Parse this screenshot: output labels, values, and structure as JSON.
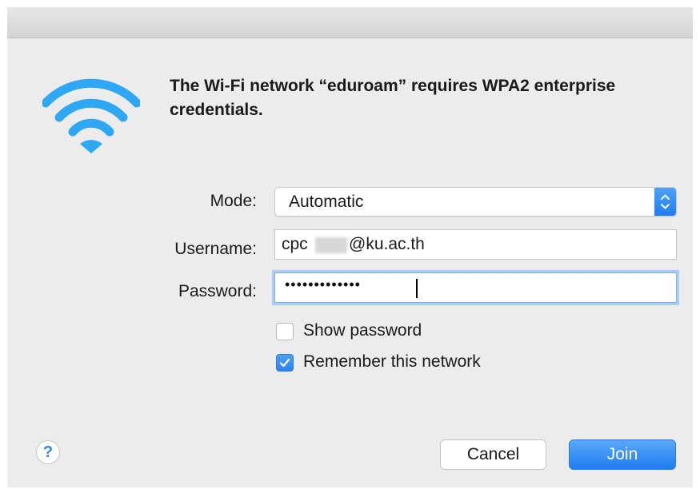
{
  "dialog": {
    "heading": "The Wi-Fi network “eduroam” requires WPA2 enterprise credentials.",
    "icon": "wifi-icon",
    "accent_color": "#2f86f0"
  },
  "form": {
    "mode": {
      "label": "Mode:",
      "value": "Automatic"
    },
    "username": {
      "label": "Username:",
      "value_prefix": "cpc",
      "value_suffix": "@ku.ac.th"
    },
    "password": {
      "label": "Password:",
      "masked_value": "•••••••••••••"
    }
  },
  "options": {
    "show_password": {
      "label": "Show password",
      "checked": false
    },
    "remember_network": {
      "label": "Remember this network",
      "checked": true
    }
  },
  "buttons": {
    "help": "?",
    "cancel": "Cancel",
    "join": "Join"
  }
}
